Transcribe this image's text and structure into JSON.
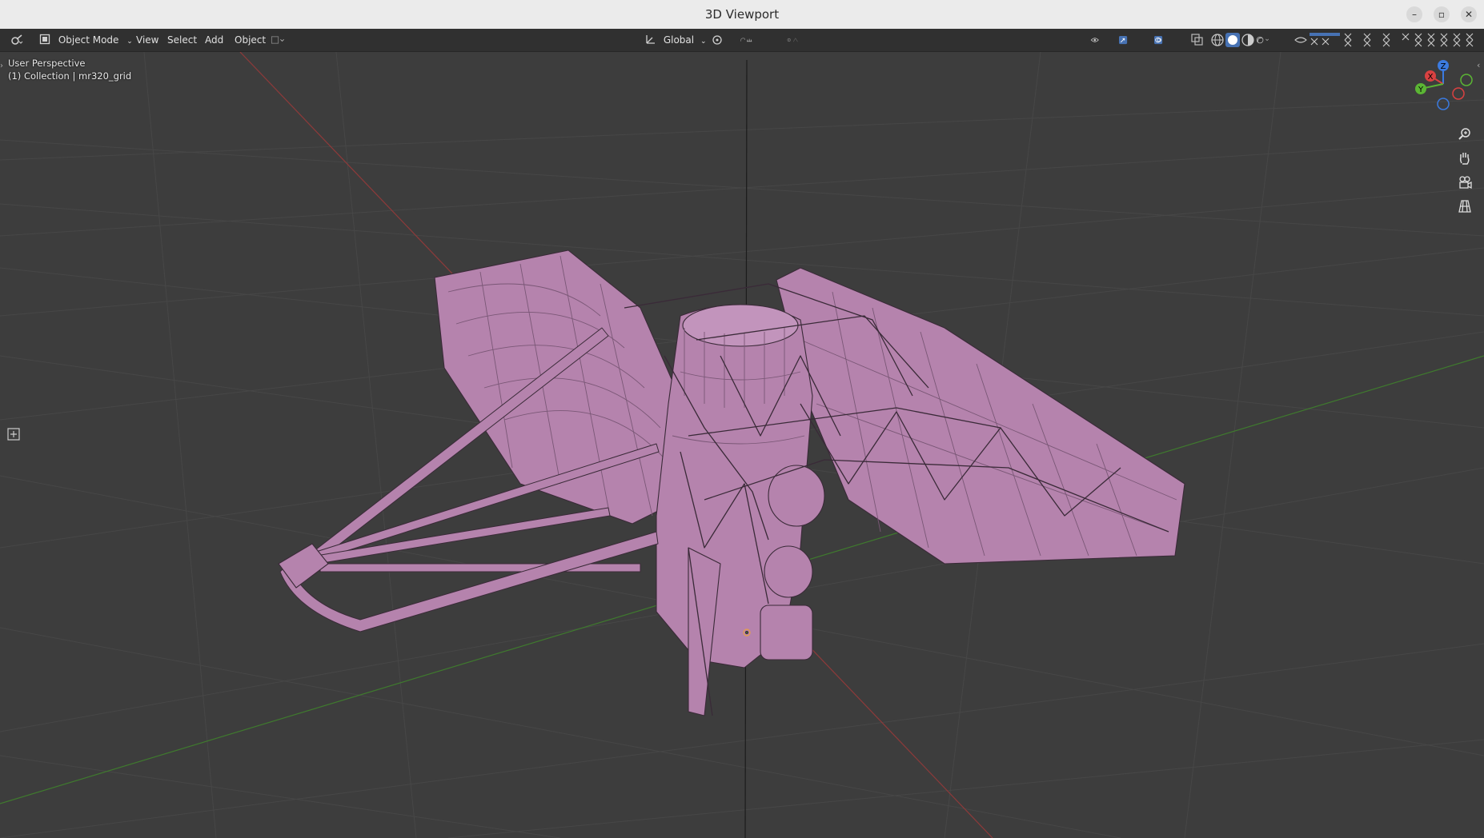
{
  "window": {
    "title": "3D Viewport"
  },
  "header": {
    "mode_label": "Object Mode",
    "menus": [
      "View",
      "Select",
      "Add",
      "Object"
    ],
    "orientation_label": "Global"
  },
  "viewport": {
    "perspective_label": "User Perspective",
    "collection_label": "(1) Collection | mr320_grid"
  },
  "gizmo": {
    "axis_x": "X",
    "axis_y": "Y",
    "axis_z": "Z"
  },
  "colors": {
    "model": "#b583ad",
    "model_edge": "#3a2a38",
    "background": "#3d3d3d",
    "grid": "#484848",
    "x_axis": "#8e3a3a",
    "y_axis": "#3f7a2e",
    "accent": "#4772b3"
  },
  "icons": [
    "editor-type-icon",
    "object-mode-icon",
    "transform-orientation-icon",
    "pivot-icon",
    "snap-icon",
    "proportional-edit-icon",
    "visibility-icon",
    "gizmo-icon",
    "overlay-icon",
    "xray-icon",
    "wireframe-shading-icon",
    "solid-shading-icon",
    "material-shading-icon",
    "rendered-shading-icon",
    "zoom-icon",
    "pan-hand-icon",
    "camera-icon",
    "grid-view-icon",
    "toolbar-toggle-icon"
  ]
}
